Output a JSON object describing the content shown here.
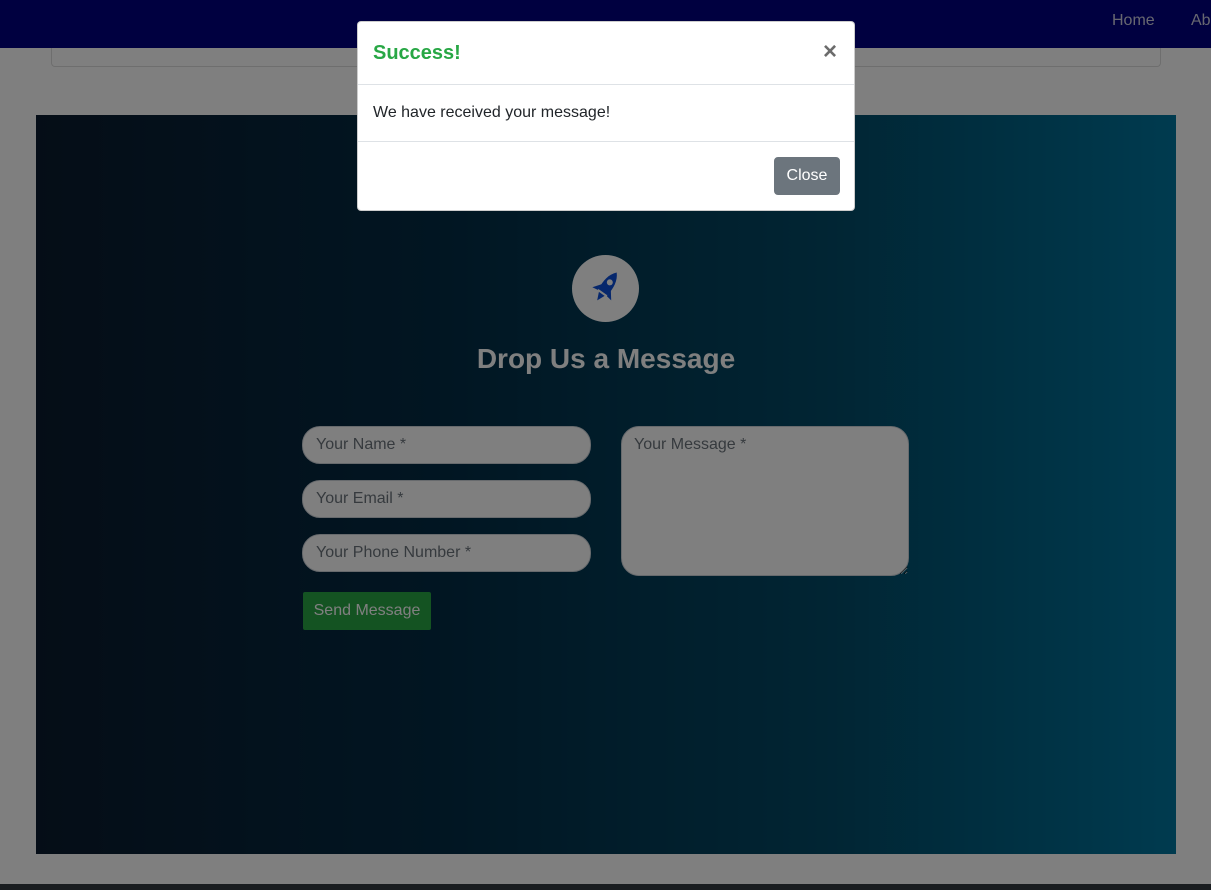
{
  "navbar": {
    "links": [
      {
        "label": "Home"
      },
      {
        "label": "Ab"
      }
    ]
  },
  "contact": {
    "heading": "Drop Us a Message",
    "icon": "rocket-icon",
    "fields": {
      "name_placeholder": "Your Name *",
      "email_placeholder": "Your Email *",
      "phone_placeholder": "Your Phone Number *",
      "message_placeholder": "Your Message *"
    },
    "send_label": "Send Message"
  },
  "modal": {
    "title": "Success!",
    "close_symbol": "×",
    "message": "We have received your message!",
    "close_label": "Close"
  },
  "colors": {
    "navbar": "#000080",
    "success": "#28a745",
    "secondary": "#6c757d",
    "rocket": "#0d4ed8"
  }
}
